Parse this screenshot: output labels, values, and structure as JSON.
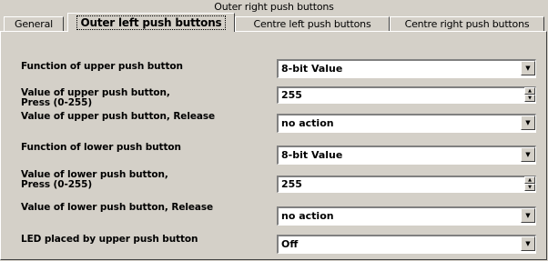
{
  "window": {
    "title": "Outer right push buttons"
  },
  "tabs": [
    {
      "label": "General"
    },
    {
      "label": "Outer left push buttons"
    },
    {
      "label": "Centre left push buttons"
    },
    {
      "label": "Centre right push buttons"
    }
  ],
  "active_tab": "Outer left push buttons",
  "rows": [
    {
      "label": "Function of upper push button",
      "value": "8-bit Value",
      "control": "dropdown"
    },
    {
      "label": "Value of upper push button,",
      "label2": "Press (0-255)",
      "value": "255",
      "control": "spinner"
    },
    {
      "label": "Value of upper push button, Release",
      "value": "no action",
      "control": "dropdown"
    },
    {
      "label": "Function of lower push button",
      "value": "8-bit Value",
      "control": "dropdown"
    },
    {
      "label": "Value of lower push button,",
      "label2": "Press (0-255)",
      "value": "255",
      "control": "spinner"
    },
    {
      "label": "Value of lower push button, Release",
      "value": "no action",
      "control": "dropdown"
    },
    {
      "label": "LED placed by upper push button",
      "value": "Off",
      "control": "dropdown"
    }
  ],
  "icons": {
    "dropdown": "▼",
    "spin_up": "▲",
    "spin_down": "▼"
  }
}
